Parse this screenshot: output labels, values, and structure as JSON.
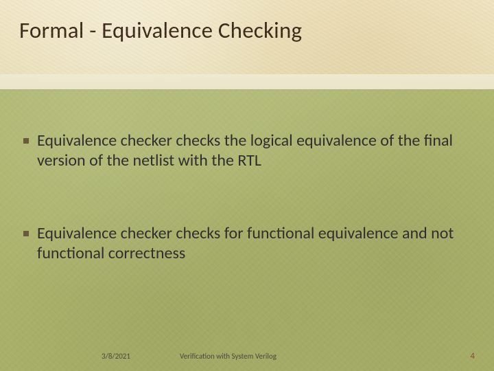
{
  "title": "Formal  - Equivalence Checking",
  "bullets": [
    "Equivalence checker checks the logical equivalence of the final version of the netlist with the RTL",
    "Equivalence checker checks for functional equivalence and not functional correctness"
  ],
  "footer": {
    "date": "3/8/2021",
    "center": "Verification with System Verilog",
    "page": "4"
  }
}
